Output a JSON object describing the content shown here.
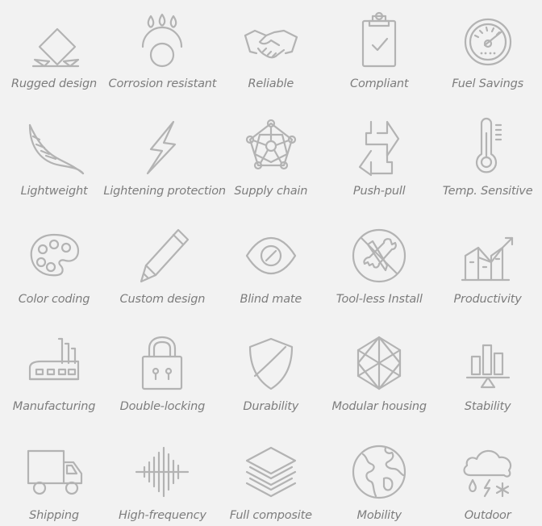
{
  "features": [
    {
      "label": "Rugged design",
      "icon": "rugged-design-icon"
    },
    {
      "label": "Corrosion resistant",
      "icon": "corrosion-resistant-icon"
    },
    {
      "label": "Reliable",
      "icon": "handshake-icon"
    },
    {
      "label": "Compliant",
      "icon": "clipboard-check-icon"
    },
    {
      "label": "Fuel Savings",
      "icon": "fuel-gauge-icon"
    },
    {
      "label": "Lightweight",
      "icon": "feather-icon"
    },
    {
      "label": "Lightening protection",
      "icon": "lightning-bolt-icon"
    },
    {
      "label": "Supply chain",
      "icon": "network-nodes-icon"
    },
    {
      "label": "Push-pull",
      "icon": "push-pull-arrows-icon"
    },
    {
      "label": "Temp. Sensitive",
      "icon": "thermometer-icon"
    },
    {
      "label": "Color coding",
      "icon": "color-palette-icon"
    },
    {
      "label": "Custom design",
      "icon": "pencil-icon"
    },
    {
      "label": "Blind mate",
      "icon": "eye-slash-icon"
    },
    {
      "label": "Tool-less Install",
      "icon": "no-tools-icon"
    },
    {
      "label": "Productivity",
      "icon": "rising-chart-icon"
    },
    {
      "label": "Manufacturing",
      "icon": "factory-icon"
    },
    {
      "label": "Double-locking",
      "icon": "padlock-icon"
    },
    {
      "label": "Durability",
      "icon": "shield-icon"
    },
    {
      "label": "Modular housing",
      "icon": "hexagon-cube-icon"
    },
    {
      "label": "Stability",
      "icon": "balance-bars-icon"
    },
    {
      "label": "Shipping",
      "icon": "truck-icon"
    },
    {
      "label": "High-frequency",
      "icon": "frequency-wave-icon"
    },
    {
      "label": "Full composite",
      "icon": "layers-icon"
    },
    {
      "label": "Mobility",
      "icon": "globe-icon"
    },
    {
      "label": "Outdoor",
      "icon": "weather-cloud-icon"
    }
  ],
  "colors": {
    "background": "#f2f2f2",
    "icon_stroke": "#b3b3b3",
    "label_text": "#7d7d7d"
  }
}
